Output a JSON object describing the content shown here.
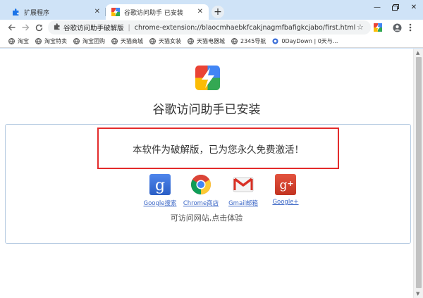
{
  "tabs": [
    {
      "title": "扩展程序",
      "icon": "puzzle-icon",
      "active": false
    },
    {
      "title": "谷歌访问助手 已安装",
      "icon": "extension-logo-icon",
      "active": true
    }
  ],
  "toolbar": {
    "extension_name": "谷歌访问助手破解版",
    "url": "chrome-extension://blaocmhaebkfcakjnagmfbafigkcjabo/first.html"
  },
  "bookmarks": [
    "淘宝",
    "淘宝特卖",
    "淘宝团购",
    "天猫商城",
    "天猫女装",
    "天猫电器城",
    "2345导航",
    "0DayDown | 0天与..."
  ],
  "page": {
    "headline": "谷歌访问助手已安装",
    "notice": "本软件为破解版，已为您永久免费激活！",
    "apps": [
      {
        "label": "Google搜索",
        "icon": "google-search-icon"
      },
      {
        "label": "Chrome商店",
        "icon": "chrome-store-icon"
      },
      {
        "label": "Gmail邮箱",
        "icon": "gmail-icon"
      },
      {
        "label": "Google+",
        "icon": "google-plus-icon"
      }
    ],
    "visit_text": "可访问网站,点击体验"
  },
  "colors": {
    "frame": "#cfe3f7",
    "highlight_border": "#e32b2b",
    "link": "#3a66c6",
    "card_border": "#b6cbe2"
  }
}
